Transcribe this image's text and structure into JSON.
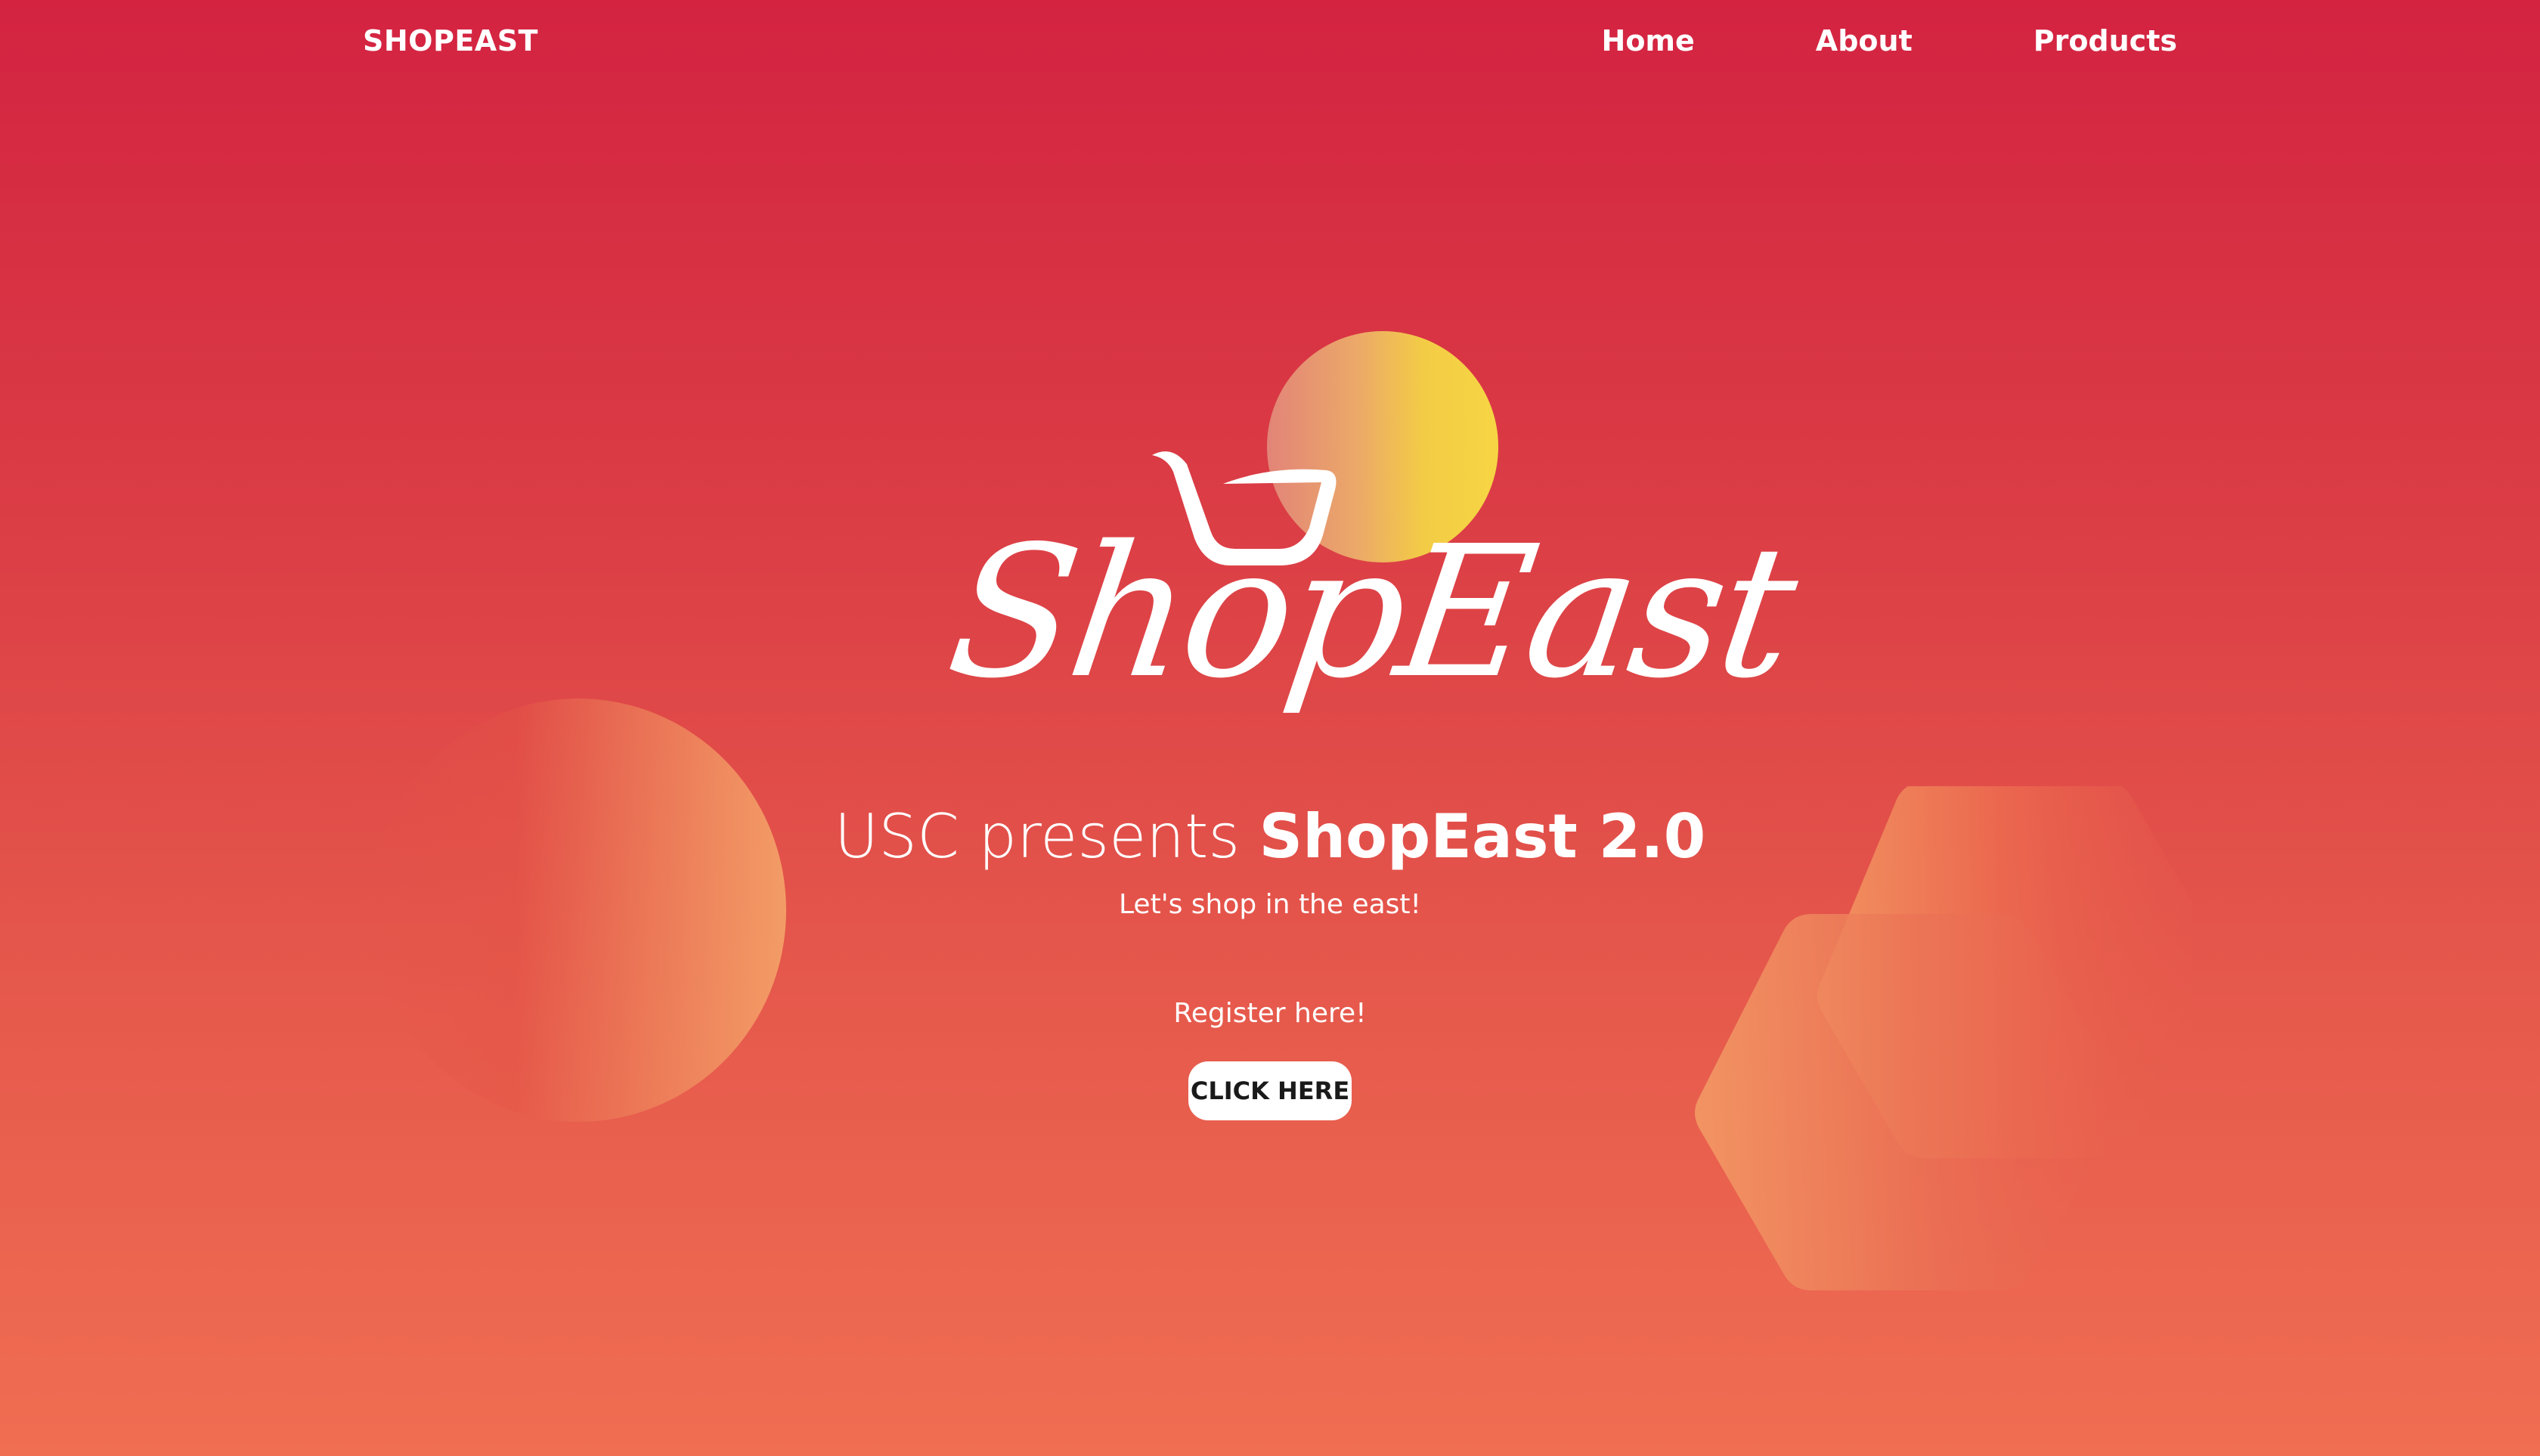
{
  "nav": {
    "brand": "SHOPEAST",
    "links": [
      {
        "label": "Home"
      },
      {
        "label": "About"
      },
      {
        "label": "Products"
      }
    ]
  },
  "hero": {
    "logo_text": "ShopEast",
    "headline_prefix": "USC presents ",
    "headline_strong": "ShopEast 2.0",
    "tagline": "Let's shop in the east!",
    "register_text": "Register here!",
    "cta_label": "CLICK HERE"
  },
  "colors": {
    "gradient_top": "#d32341",
    "gradient_bottom": "#f06e52",
    "sun_yellow": "#f6d544",
    "cta_background": "#ffffff",
    "cta_text": "#1a1a1a"
  },
  "icons": {
    "logo": "shopping-cart-icon"
  }
}
